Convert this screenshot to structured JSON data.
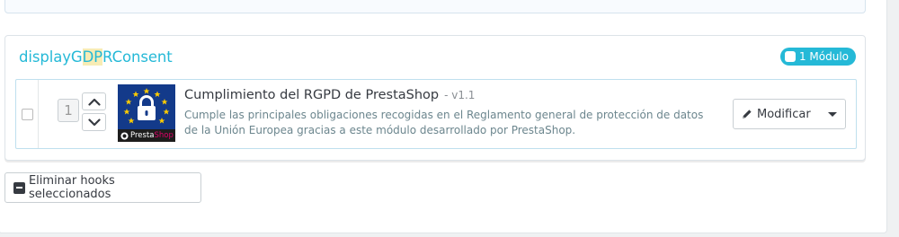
{
  "hook": {
    "name_prefix": "displayG",
    "name_highlight": "DP",
    "name_suffix": "RConsent",
    "module_count_label": "1 Módulo"
  },
  "module": {
    "position": "1",
    "name": "Cumplimiento del RGPD de PrestaShop",
    "version": "- v1.1",
    "description": "Cumple las principales obligaciones recogidas en el Reglamento general de protección de datos de la Unión Europea gracias a este módulo desarrollado por PrestaShop.",
    "logo_brand_prefix": "Presta",
    "logo_brand_suffix": "Shop",
    "modify_label": "Modificar"
  },
  "actions": {
    "delete_selected_label": "Eliminar hooks seleccionados"
  },
  "colors": {
    "accent": "#25b9d7",
    "highlight": "#f7ecb5",
    "text": "#363a41",
    "muted": "#6c868e",
    "logo_bg": "#133a8a"
  },
  "icons": [
    "check-icon",
    "chevron-up-icon",
    "chevron-down-icon",
    "lock-icon",
    "prestashop-logo-icon",
    "pencil-icon",
    "caret-down-icon",
    "minus-square-icon"
  ]
}
